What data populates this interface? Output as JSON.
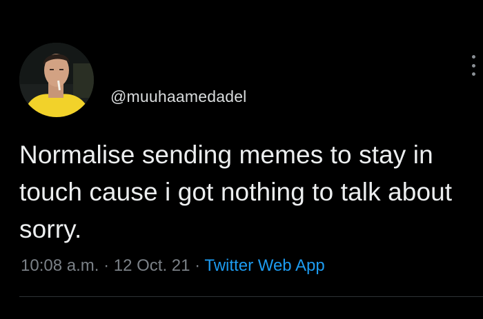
{
  "tweet": {
    "handle": "@muuhaamedadel",
    "text": "Normalise sending memes to stay in touch cause i got nothing to talk about sorry.",
    "time": "10:08 a.m.",
    "separator": "·",
    "date": "12 Oct. 21",
    "source": "Twitter Web App"
  },
  "icons": {
    "avatar": "profile-photo",
    "more": "more-options-vertical-dots"
  },
  "colors": {
    "background": "#000000",
    "text": "#eceeef",
    "muted": "#7b8187",
    "link": "#1d9bf0"
  }
}
